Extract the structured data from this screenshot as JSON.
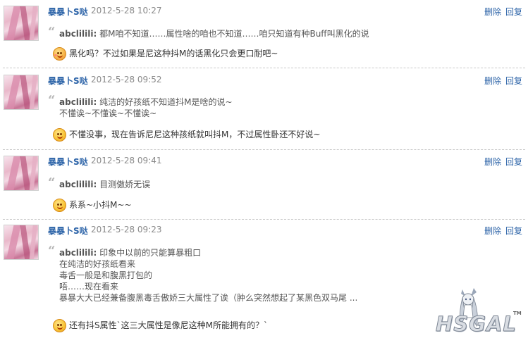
{
  "comments": [
    {
      "author": "暴暴卜S哒",
      "time": "2012-5-28 10:27",
      "delete_label": "删除",
      "reply_label": "回复",
      "quote_name": "abclilili:",
      "quote_lines": [
        "都M咱不知道……属性啥的咱也不知道……咱只知道有种Buff叫黑化的说"
      ],
      "reply_icon": "blush-face-icon",
      "reply_text": "黑化吗？不过如果是尼这种抖M的话黑化只会更口耐吧~"
    },
    {
      "author": "暴暴卜S哒",
      "time": "2012-5-28 09:52",
      "delete_label": "删除",
      "reply_label": "回复",
      "quote_name": "abclilili:",
      "quote_lines": [
        "纯洁的好孩纸不知道抖M是啥的说~",
        "不懂诶~不懂诶~不懂诶~"
      ],
      "reply_icon": "grin-face-icon",
      "reply_text": "不懂没事，现在告诉尼尼这种孩纸就叫抖M，不过属性卧还不好说~"
    },
    {
      "author": "暴暴卜S哒",
      "time": "2012-5-28 09:41",
      "delete_label": "删除",
      "reply_label": "回复",
      "quote_name": "abclilili:",
      "quote_lines": [
        "目测傲娇无误"
      ],
      "reply_icon": "grin-face-icon",
      "reply_text": "系系~小抖M~~"
    },
    {
      "author": "暴暴卜S哒",
      "time": "2012-5-28 09:23",
      "delete_label": "删除",
      "reply_label": "回复",
      "quote_name": "abclilili:",
      "quote_lines": [
        "印象中以前的只能算暴粗口",
        "在纯洁的好孩纸看来",
        "毒舌一般是和腹黑打包的",
        "唔……现在看来",
        "暴暴大大已经兼备腹黑毒舌傲娇三大属性了诶（肿么突然想起了某黑色双马尾 ..."
      ],
      "reply_icon": "smirk-face-icon",
      "reply_text": "还有抖S属性`这三大属性是像尼这种M所能拥有的？`"
    }
  ],
  "watermark": {
    "brand": "HSGAL",
    "tm": "TM"
  }
}
